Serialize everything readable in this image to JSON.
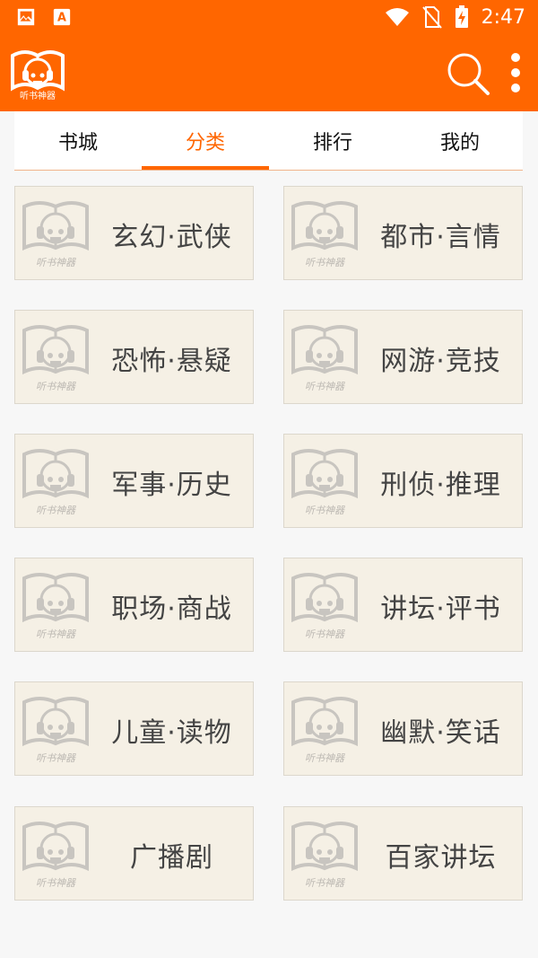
{
  "status_bar": {
    "time": "2:47",
    "left_icons": [
      "image-icon",
      "store-icon"
    ],
    "right_icons": [
      "wifi-icon",
      "no-sim-icon",
      "battery-charging-icon"
    ]
  },
  "app_bar": {
    "logo_text": "听书神器",
    "search_icon": "search-icon",
    "more_icon": "more-vert-icon"
  },
  "tabs": [
    {
      "label": "书城",
      "active": false
    },
    {
      "label": "分类",
      "active": true
    },
    {
      "label": "排行",
      "active": false
    },
    {
      "label": "我的",
      "active": false
    }
  ],
  "categories": [
    {
      "label": "玄幻·武侠",
      "thumb_text": "听书神器"
    },
    {
      "label": "都市·言情",
      "thumb_text": "听书神器"
    },
    {
      "label": "恐怖·悬疑",
      "thumb_text": "听书神器"
    },
    {
      "label": "网游·竞技",
      "thumb_text": "听书神器"
    },
    {
      "label": "军事·历史",
      "thumb_text": "听书神器"
    },
    {
      "label": "刑侦·推理",
      "thumb_text": "听书神器"
    },
    {
      "label": "职场·商战",
      "thumb_text": "听书神器"
    },
    {
      "label": "讲坛·评书",
      "thumb_text": "听书神器"
    },
    {
      "label": "儿童·读物",
      "thumb_text": "听书神器"
    },
    {
      "label": "幽默·笑话",
      "thumb_text": "听书神器"
    },
    {
      "label": "广播剧",
      "thumb_text": "听书神器"
    },
    {
      "label": "百家讲坛",
      "thumb_text": "听书神器"
    }
  ],
  "colors": {
    "accent": "#ff6600",
    "card_bg": "#f5f0e5",
    "page_bg": "#f7f7f7"
  }
}
